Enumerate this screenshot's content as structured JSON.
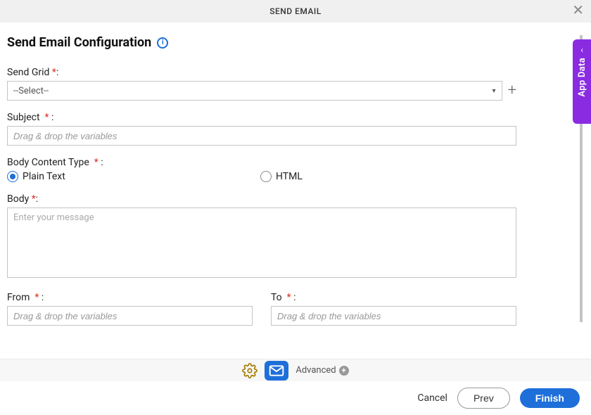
{
  "header": {
    "title": "SEND EMAIL"
  },
  "page": {
    "title": "Send Email Configuration"
  },
  "sidebar": {
    "app_data_label": "App Data"
  },
  "fields": {
    "send_grid": {
      "label": "Send Grid",
      "placeholder": "--Select--"
    },
    "subject": {
      "label": "Subject",
      "placeholder": "Drag & drop the variables"
    },
    "body_content_type": {
      "label": "Body Content Type",
      "options": {
        "plain_text": "Plain Text",
        "html": "HTML"
      }
    },
    "body": {
      "label": "Body",
      "placeholder": "Enter your message"
    },
    "from": {
      "label": "From",
      "placeholder": "Drag & drop the variables"
    },
    "to": {
      "label": "To",
      "placeholder": "Drag & drop the variables"
    }
  },
  "midbar": {
    "advanced_label": "Advanced"
  },
  "footer": {
    "cancel": "Cancel",
    "prev": "Prev",
    "finish": "Finish"
  }
}
